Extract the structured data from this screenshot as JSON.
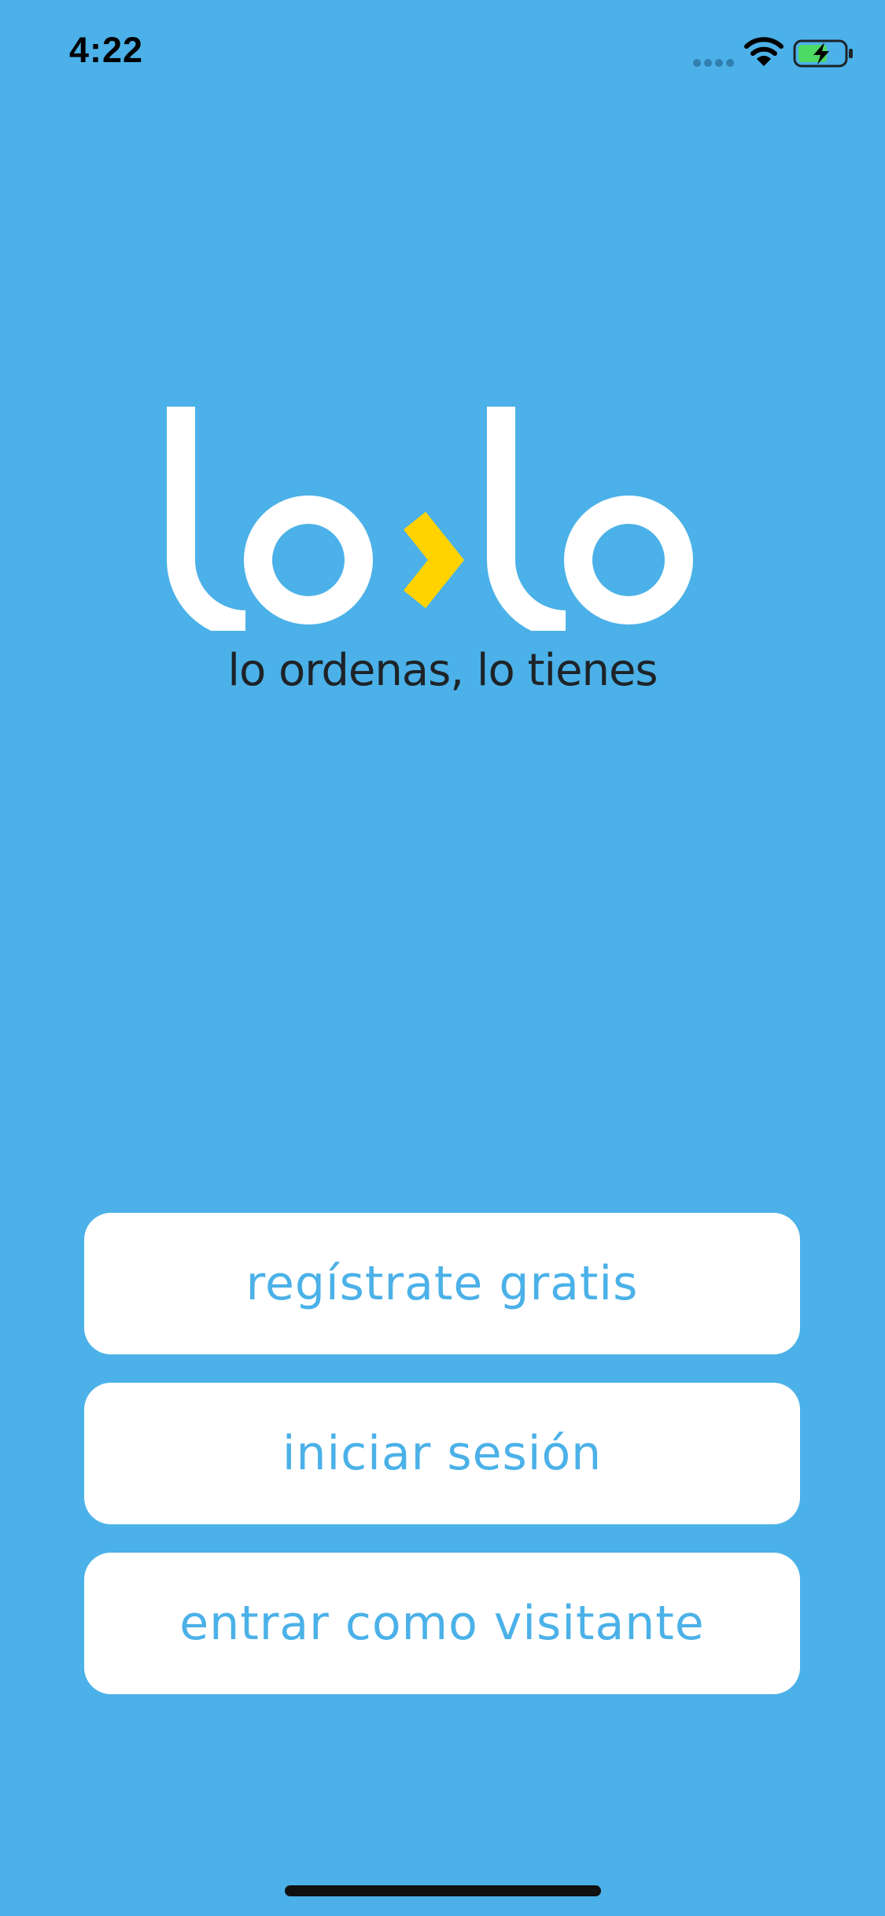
{
  "status_bar": {
    "time": "4:22",
    "signal_icon": "cellular-signal-icon",
    "wifi_icon": "wifi-icon",
    "battery_icon": "battery-charging-icon"
  },
  "brand": {
    "logo_text": "lo›lo",
    "tagline": "lo ordenas, lo tienes",
    "accent_color": "#FFD200",
    "background_color": "#4BB1E8"
  },
  "actions": {
    "register_label": "regístrate gratis",
    "login_label": "iniciar sesión",
    "guest_label": "entrar como visitante"
  }
}
